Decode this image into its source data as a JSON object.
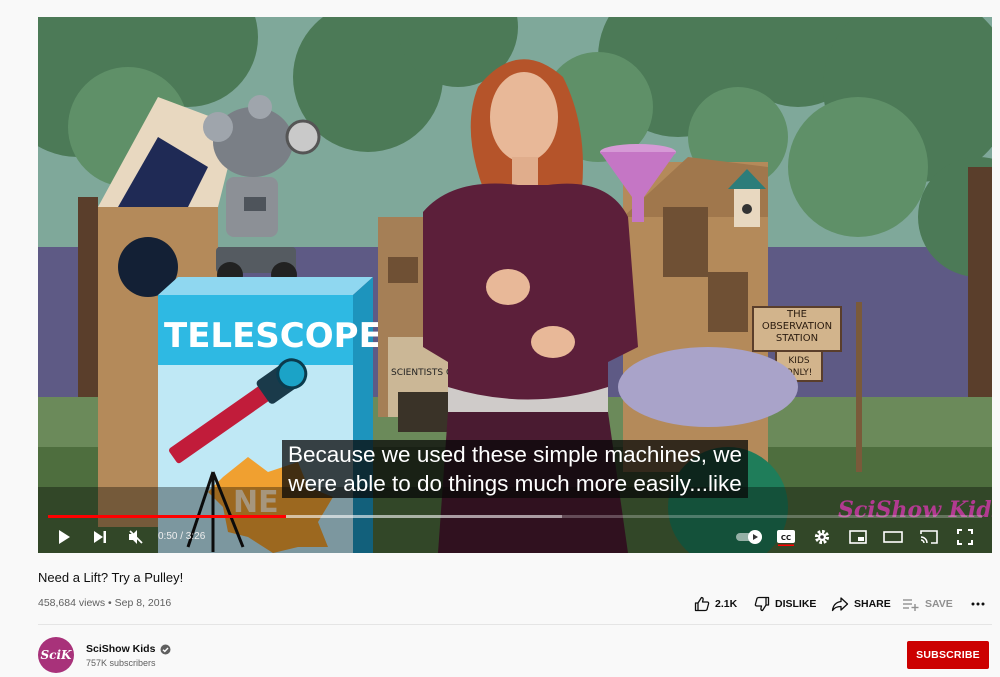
{
  "player": {
    "subtitles": [
      "Because we used these simple machines, we",
      "were able to do things much more easily...like"
    ],
    "progress_fraction": 0.255,
    "buffered_fraction": 0.55,
    "time": "0:50 / 3:26",
    "watermark": "SciShow Kids!",
    "scene_text": {
      "telescope": "TELESCOPE!",
      "new_badge": "NE",
      "sign_scientists": "SCIENTISTS ONLY",
      "sign_station": [
        "THE",
        "OBSERVATION",
        "STATION"
      ],
      "sign_kids": [
        "KIDS",
        "ONLY!"
      ]
    },
    "controls": {
      "play": "play-icon",
      "next": "next-icon",
      "mute": "muted-volume-icon",
      "autoplay": "autoplay-toggle",
      "captions": "cc-icon",
      "settings": "gear-icon",
      "miniplayer": "miniplayer-icon",
      "theater": "theater-mode-icon",
      "cast": "cast-icon",
      "fullscreen": "fullscreen-icon"
    },
    "accent_color": "#ff0000"
  },
  "video": {
    "title": "Need a Lift? Try a Pulley!",
    "meta": "458,684 views • Sep 8, 2016"
  },
  "actions": {
    "like": "2.1K",
    "dislike": "DISLIKE",
    "share": "SHARE",
    "save": "SAVE"
  },
  "channel": {
    "name": "SciShow Kids",
    "avatar_text": "SciK",
    "subscribers": "757K subscribers",
    "subscribe_label": "SUBSCRIBE",
    "brand_color": "#cc0000"
  }
}
